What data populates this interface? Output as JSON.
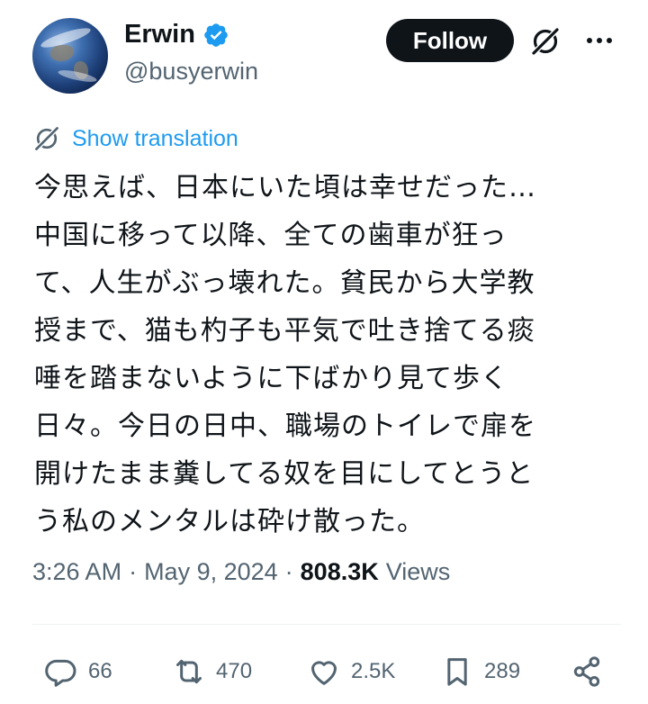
{
  "header": {
    "display_name": "Erwin",
    "handle": "@busyerwin",
    "follow_label": "Follow",
    "verified_icon": "verified-badge-icon",
    "verified_color": "#1d9bf0"
  },
  "translation": {
    "label": "Show translation",
    "color": "#1d9bf0"
  },
  "tweet": {
    "text": "今思えば、日本にいた頃は幸せだった…\n中国に移って以降、全ての歯車が狂っ\nて、人生がぶっ壊れた。貧民から大学教\n授まで、猫も杓子も平気で吐き捨てる痰\n唾を踏まないように下ばかり見て歩く\n日々。今日の日中、職場のトイレで扉を\n開けたまま糞してる奴を目にしてとうと\nう私のメンタルは砕け散った。"
  },
  "meta": {
    "time": "3:26 AM",
    "sep1": "·",
    "date": "May 9, 2024",
    "sep2": "·",
    "views_count": "808.3K",
    "views_label": "Views"
  },
  "actions": {
    "replies": "66",
    "reposts": "470",
    "likes": "2.5K",
    "bookmarks": "289"
  }
}
